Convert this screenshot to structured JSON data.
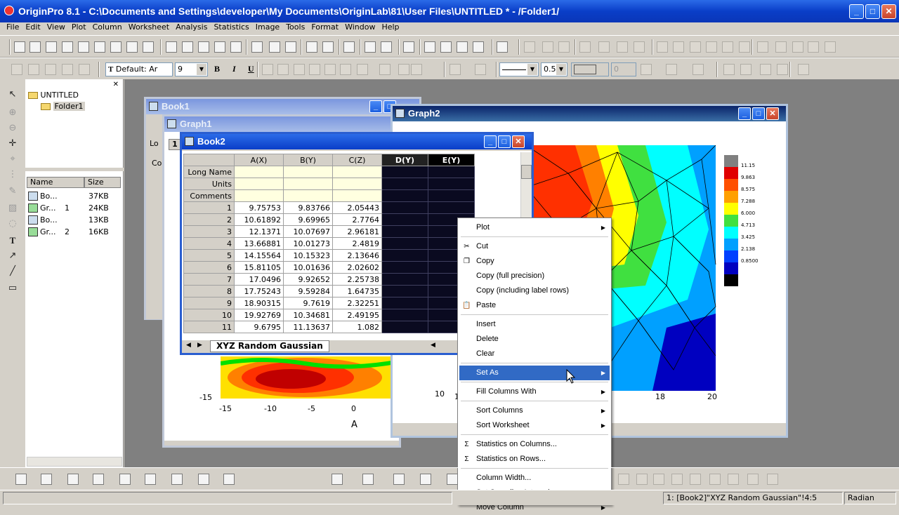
{
  "app": {
    "title": "OriginPro 8.1 - C:\\Documents and Settings\\developer\\My Documents\\OriginLab\\81\\User Files\\UNTITLED * - /Folder1/",
    "win_min": "_",
    "win_max": "□",
    "win_close": "✕"
  },
  "menu": [
    "File",
    "Edit",
    "View",
    "Plot",
    "Column",
    "Worksheet",
    "Analysis",
    "Statistics",
    "Image",
    "Tools",
    "Format",
    "Window",
    "Help"
  ],
  "format_toolbar": {
    "font_name": "Default: Ar",
    "font_size": "9",
    "bold": "B",
    "italic": "I",
    "underline": "U",
    "line_width": "0.5",
    "pattern_num": "0"
  },
  "explorer": {
    "root": "UNTITLED",
    "folder": "Folder1",
    "col_name": "Name",
    "col_size": "Size",
    "items": [
      {
        "name": "Bo...",
        "num": "",
        "size": "37KB"
      },
      {
        "name": "Gr...",
        "num": "1",
        "size": "24KB"
      },
      {
        "name": "Bo...",
        "num": "",
        "size": "13KB"
      },
      {
        "name": "Gr...",
        "num": "2",
        "size": "16KB"
      }
    ]
  },
  "windows": {
    "book1": "Book1",
    "graph1": "Graph1",
    "graph2": "Graph2",
    "book2": "Book2"
  },
  "book1_fragments": {
    "col_num": "1",
    "label1": "Lo",
    "label2": "Co"
  },
  "book2": {
    "columns": [
      "A(X)",
      "B(Y)",
      "C(Z)",
      "D(Y)",
      "E(Y)"
    ],
    "row_labels": [
      "Long Name",
      "Units",
      "Comments"
    ],
    "rows": [
      {
        "n": "1",
        "a": "9.75753",
        "b": "9.83766",
        "c": "2.05443"
      },
      {
        "n": "2",
        "a": "10.61892",
        "b": "9.69965",
        "c": "2.7764"
      },
      {
        "n": "3",
        "a": "12.1371",
        "b": "10.07697",
        "c": "2.96181"
      },
      {
        "n": "4",
        "a": "13.66881",
        "b": "10.01273",
        "c": "2.4819"
      },
      {
        "n": "5",
        "a": "14.15564",
        "b": "10.15323",
        "c": "2.13646"
      },
      {
        "n": "6",
        "a": "15.81105",
        "b": "10.01636",
        "c": "2.02602"
      },
      {
        "n": "7",
        "a": "17.0496",
        "b": "9.92652",
        "c": "2.25738"
      },
      {
        "n": "8",
        "a": "17.75243",
        "b": "9.59284",
        "c": "1.64735"
      },
      {
        "n": "9",
        "a": "18.90315",
        "b": "9.7619",
        "c": "2.32251"
      },
      {
        "n": "10",
        "a": "19.92769",
        "b": "10.34681",
        "c": "2.49195"
      },
      {
        "n": "11",
        "a": "9.6795",
        "b": "11.13637",
        "c": "1.082"
      }
    ],
    "sheet_tab": "XYZ Random Gaussian"
  },
  "graph1": {
    "x_ticks": [
      "-15",
      "-10",
      "-5",
      "0"
    ],
    "y_tick": "-15",
    "xlabel": "A"
  },
  "graph2": {
    "x_ticks": [
      "18",
      "20"
    ],
    "y_tick": "10",
    "x_tick_partial": "1",
    "legend_levels": [
      "11.15",
      "9.863",
      "8.575",
      "7.288",
      "6.000",
      "4.713",
      "3.425",
      "2.138",
      "0.8500"
    ],
    "legend_colors": [
      "#808080",
      "#e00000",
      "#ff5000",
      "#ffa000",
      "#ffff00",
      "#40e040",
      "#00ffff",
      "#00a0ff",
      "#0040ff",
      "#0000c0",
      "#000000"
    ]
  },
  "context_menu": [
    {
      "label": "Plot",
      "submenu": true
    },
    {
      "sep": true
    },
    {
      "label": "Cut",
      "icon": "scissors-icon"
    },
    {
      "label": "Copy",
      "icon": "copy-icon"
    },
    {
      "label": "Copy (full precision)"
    },
    {
      "label": "Copy (including label rows)"
    },
    {
      "label": "Paste",
      "icon": "paste-icon"
    },
    {
      "sep": true
    },
    {
      "label": "Insert"
    },
    {
      "label": "Delete"
    },
    {
      "label": "Clear"
    },
    {
      "sep": true
    },
    {
      "label": "Set As",
      "submenu": true,
      "highlight": true
    },
    {
      "sep": true
    },
    {
      "label": "Fill Columns With",
      "submenu": true
    },
    {
      "sep": true
    },
    {
      "label": "Sort Columns",
      "submenu": true
    },
    {
      "label": "Sort Worksheet",
      "submenu": true
    },
    {
      "sep": true
    },
    {
      "label": "Statistics on Columns...",
      "icon": "sigma-icon"
    },
    {
      "label": "Statistics on Rows...",
      "icon": "sigma-icon"
    },
    {
      "sep": true
    },
    {
      "label": "Column Width..."
    },
    {
      "label": "Set Sampling Interval..."
    },
    {
      "label": "Move Column",
      "submenu": true
    }
  ],
  "status": {
    "sheet_ref": "1: [Book2]\"XYZ Random Gaussian\"!4:5",
    "angle": "Radian"
  }
}
